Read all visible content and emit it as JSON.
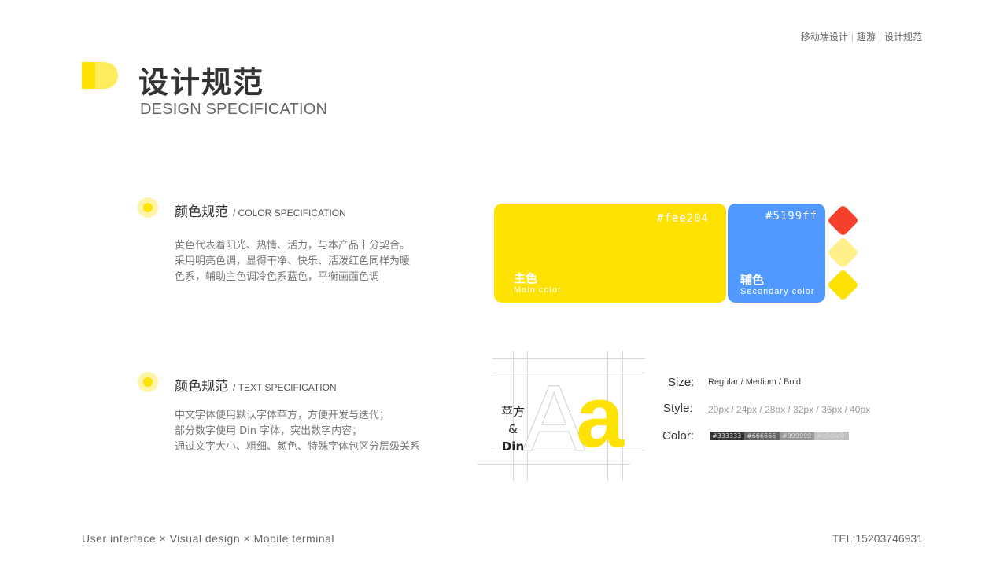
{
  "nav": {
    "item1": "移动端设计",
    "item2": "趣游",
    "item3": "设计规范",
    "separator": "|"
  },
  "header": {
    "title": "设计规范",
    "subtitle": "DESIGN SPECIFICATION"
  },
  "color_section": {
    "title": "颜色规范",
    "subtitle": "/ COLOR SPECIFICATION",
    "desc": [
      "黄色代表着阳光、热情、活力，与本产品十分契合。",
      "采用明亮色调，显得干净、快乐、活泼红色同样为暖",
      "色系，辅助主色调冷色系蓝色，平衡画面色调"
    ]
  },
  "colors": {
    "main": {
      "hex": "#fee204",
      "name": "主色",
      "name_en": "Main color"
    },
    "secondary": {
      "hex": "#5199ff",
      "name": "辅色",
      "name_en": "Secondary color"
    },
    "accents": [
      "#f5402c",
      "#fff08a",
      "#fee204"
    ]
  },
  "text_section": {
    "title": "颜色规范",
    "subtitle": "/ TEXT SPECIFICATION",
    "desc": [
      "中文字体使用默认字体苹方，方便开发与迭代；",
      "部分数字使用 Din 字体，突出数字内容；",
      "通过文字大小、粗细、颜色、特殊字体包区分层级关系"
    ]
  },
  "typography": {
    "sample_upper": "A",
    "sample_lower": "a",
    "font1": "苹方",
    "amp": "&",
    "font2": "Din",
    "size_label": "Size:",
    "size_value": "Regular / Medium / Bold",
    "style_label": "Style:",
    "style_value": "20px / 24px / 28px / 32px / 36px / 40px",
    "color_label": "Color:",
    "swatches": [
      {
        "label": "#333333",
        "color": "#333333"
      },
      {
        "label": "#666666",
        "color": "#666666"
      },
      {
        "label": "#999999",
        "color": "#999999"
      },
      {
        "label": "#c0c0c0",
        "color": "#c0c0c0"
      }
    ]
  },
  "footer": {
    "left": "User interface × Visual design × Mobile terminal",
    "right": "TEL:15203746931"
  }
}
